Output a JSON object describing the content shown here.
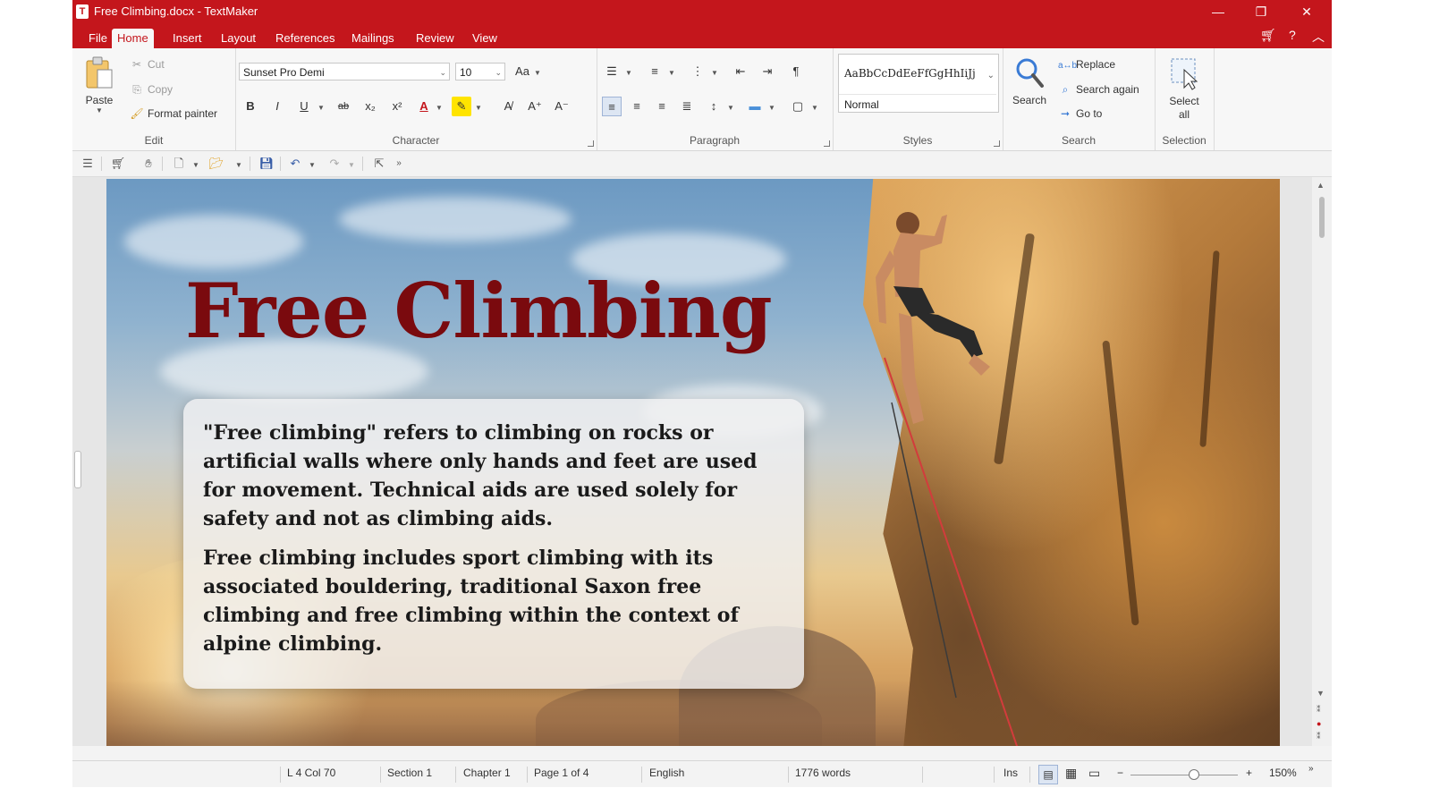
{
  "window": {
    "title": "Free Climbing.docx - TextMaker",
    "app_icon": "T",
    "minimize": "—",
    "restore": "❐",
    "close": "✕"
  },
  "menu": {
    "tabs": [
      "File",
      "Home",
      "Insert",
      "Layout",
      "References",
      "Mailings",
      "Review",
      "View"
    ],
    "active": "Home",
    "right_icons": [
      "cart-icon",
      "help-icon",
      "collapse-ribbon-icon"
    ]
  },
  "ribbon": {
    "edit": {
      "label": "Edit",
      "paste": "Paste",
      "cut": "Cut",
      "copy": "Copy",
      "format_painter": "Format painter"
    },
    "character": {
      "label": "Character",
      "font": "Sunset Pro Demi",
      "size": "10"
    },
    "paragraph": {
      "label": "Paragraph"
    },
    "styles": {
      "label": "Styles",
      "sample": "AaBbCcDdEeFfGgHhIiJj",
      "current": "Normal"
    },
    "search": {
      "label": "Search",
      "search": "Search",
      "replace": "Replace",
      "search_again": "Search again",
      "go_to": "Go to"
    },
    "selection": {
      "label": "Selection",
      "select_all_1": "Select",
      "select_all_2": "all"
    }
  },
  "document": {
    "headline": "Free Climbing",
    "paragraph1": "\"Free climbing\" refers to climbing on rocks or artificial walls where only hands and feet are used for movement. Technical aids are used solely for safety and not as climbing aids.",
    "paragraph2": "Free climbing includes sport climbing with its associated bouldering, traditional Saxon free climbing and free climbing within the context of alpine climbing."
  },
  "status": {
    "position": "L 4 Col 70",
    "section": "Section 1",
    "chapter": "Chapter 1",
    "page": "Page 1 of 4",
    "language": "English",
    "words": "1776 words",
    "mode": "Ins",
    "zoom": "150%"
  },
  "colors": {
    "brand": "#c4161c",
    "headline": "#7a0a0e"
  }
}
